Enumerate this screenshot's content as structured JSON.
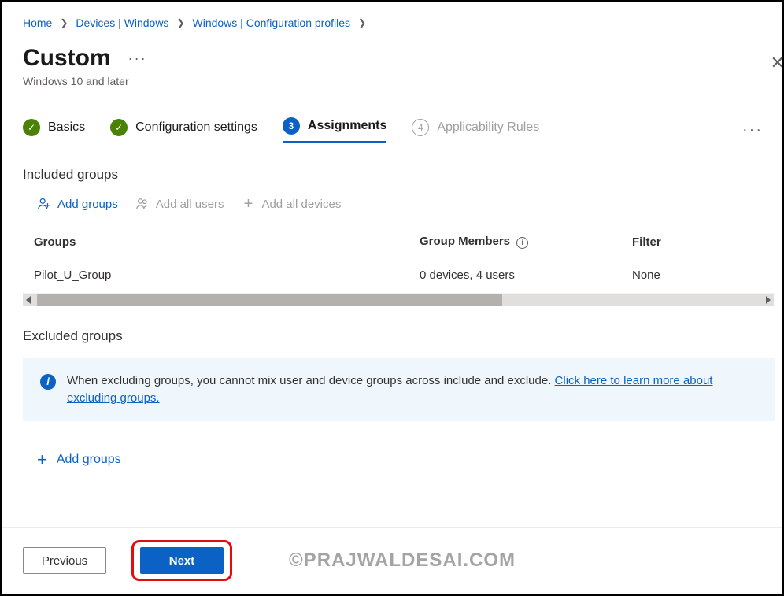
{
  "breadcrumb": {
    "items": [
      "Home",
      "Devices | Windows",
      "Windows | Configuration profiles"
    ]
  },
  "header": {
    "title": "Custom",
    "subtitle": "Windows 10 and later"
  },
  "steps": {
    "s1": {
      "label": "Basics"
    },
    "s2": {
      "label": "Configuration settings"
    },
    "s3": {
      "num": "3",
      "label": "Assignments"
    },
    "s4": {
      "num": "4",
      "label": "Applicability Rules"
    }
  },
  "included": {
    "heading": "Included groups",
    "actions": {
      "add_groups": "Add groups",
      "add_all_users": "Add all users",
      "add_all_devices": "Add all devices"
    },
    "columns": {
      "groups": "Groups",
      "members": "Group Members",
      "filter": "Filter"
    },
    "rows": [
      {
        "group": "Pilot_U_Group",
        "members": "0 devices, 4 users",
        "filter": "None"
      }
    ]
  },
  "excluded": {
    "heading": "Excluded groups",
    "banner_text": "When excluding groups, you cannot mix user and device groups across include and exclude. ",
    "banner_link": "Click here to learn more about excluding groups.",
    "add_groups": "Add groups"
  },
  "footer": {
    "previous": "Previous",
    "next": "Next"
  },
  "watermark": "©PRAJWALDESAI.COM"
}
